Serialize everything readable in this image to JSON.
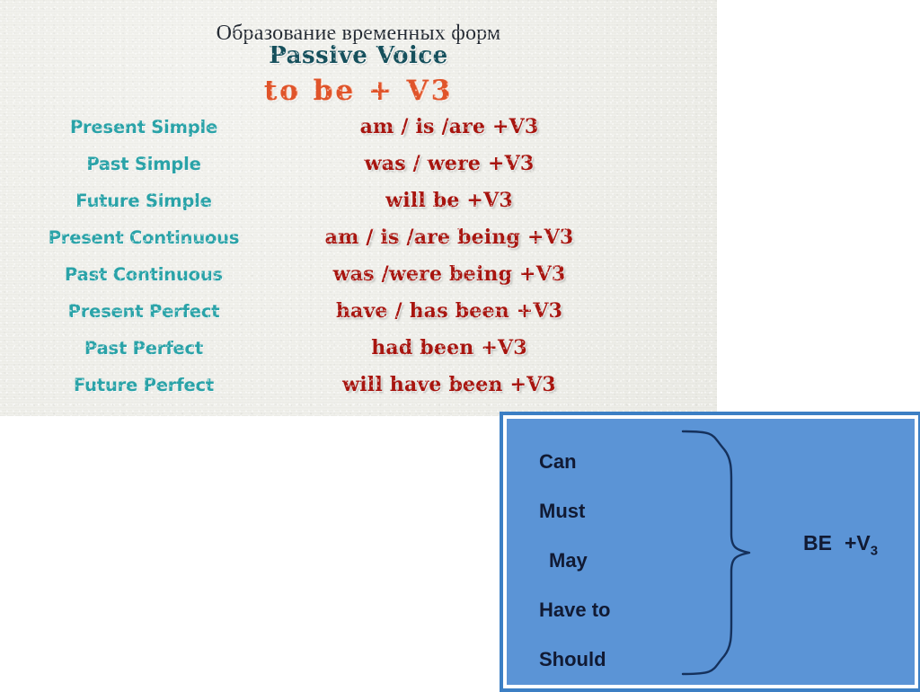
{
  "slide": {
    "title_ru": "Образование временных форм",
    "title_en": "Passive Voice",
    "formula_head": "to be + V3",
    "colors": {
      "paper": "#eeeee8",
      "title_ru": "#252b33",
      "title_en": "#16505c",
      "formula_head": "#e0542a",
      "tense": "#2aa3a8",
      "form": "#a8150f",
      "box_border": "#3c7fc4",
      "box_fill": "#5b94d6",
      "box_inner_border": "#ffffff",
      "modal_text": "#111a33"
    },
    "rows": [
      {
        "tense": "Present Simple",
        "form": "am / is /are +V3"
      },
      {
        "tense": "Past Simple",
        "form": "was / were +V3"
      },
      {
        "tense": "Future Simple",
        "form": "will be +V3"
      },
      {
        "tense": "Present Continuous",
        "form": "am / is /are being +V3"
      },
      {
        "tense": "Past Continuous",
        "form": "was /were being +V3"
      },
      {
        "tense": "Present Perfect",
        "form": "have / has been +V3"
      },
      {
        "tense": "Past Perfect",
        "form": "had been +V3"
      },
      {
        "tense": "Future Perfect",
        "form": "will have been +V3"
      }
    ]
  },
  "modal_box": {
    "modals": [
      "Can",
      "Must",
      "May",
      "Have to",
      "Should"
    ],
    "result_word": "BE",
    "result_suffix": "+V",
    "result_subscript": "3"
  }
}
